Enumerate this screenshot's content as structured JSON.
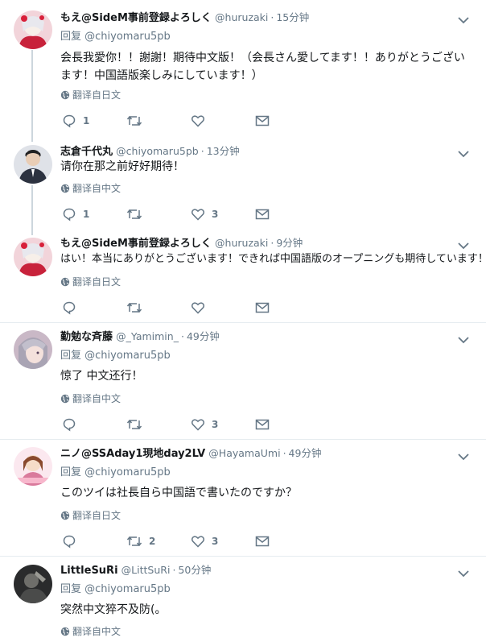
{
  "translate_icon": "globe-icon",
  "tweets": [
    {
      "name": "もえ@SideM事前登録よろしく",
      "handle": "@huruzaki",
      "sep": "·",
      "time": "15分钟",
      "reply_label": "回复",
      "reply_handle": "@chiyomaru5pb",
      "text": "会長我愛你！！謝謝！期待中文版！（会長さん愛してます！！ありがとうございます！中国語版楽しみにしています！）",
      "translate": "翻译自日文",
      "replies": "1",
      "retweets": "",
      "likes": "",
      "avatar": "anime-avatar-icon"
    },
    {
      "name": "志倉千代丸",
      "handle": "@chiyomaru5pb",
      "sep": "·",
      "time": "13分钟",
      "text": "请你在那之前好好期待！",
      "translate": "翻译自中文",
      "replies": "1",
      "retweets": "",
      "likes": "3",
      "avatar": "person-photo-avatar"
    },
    {
      "name": "もえ@SideM事前登録よろしく",
      "handle": "@huruzaki",
      "sep": "·",
      "time": "9分钟",
      "text": "はい！本当にありがとうございます！できれば中国語版のオープニングも期待しています！",
      "translate": "翻译自日文",
      "replies": "",
      "retweets": "",
      "likes": "",
      "avatar": "anime-avatar-icon"
    },
    {
      "name": "勤勉な斉藤",
      "handle": "@_Yamimin_",
      "sep": "·",
      "time": "49分钟",
      "reply_label": "回复",
      "reply_handle": "@chiyomaru5pb",
      "text": "惊了 中文还行！",
      "translate": "翻译自中文",
      "replies": "",
      "retweets": "",
      "likes": "3",
      "avatar": "anime-avatar-icon"
    },
    {
      "name": "ニノ@SSAday1現地day2LV",
      "handle": "@HayamaUmi",
      "sep": "·",
      "time": "49分钟",
      "reply_label": "回复",
      "reply_handle": "@chiyomaru5pb",
      "text": "このツイは社長自ら中国語で書いたのですか？",
      "translate": "翻译自日文",
      "replies": "",
      "retweets": "2",
      "likes": "3",
      "avatar": "anime-avatar-icon"
    },
    {
      "name": "LittleSuRi",
      "handle": "@LittSuRi",
      "sep": "·",
      "time": "50分钟",
      "reply_label": "回复",
      "reply_handle": "@chiyomaru5pb",
      "text": "突然中文猝不及防(。",
      "translate": "翻译自中文",
      "replies": "",
      "retweets": "",
      "likes": "",
      "avatar": "dark-photo-avatar"
    }
  ]
}
